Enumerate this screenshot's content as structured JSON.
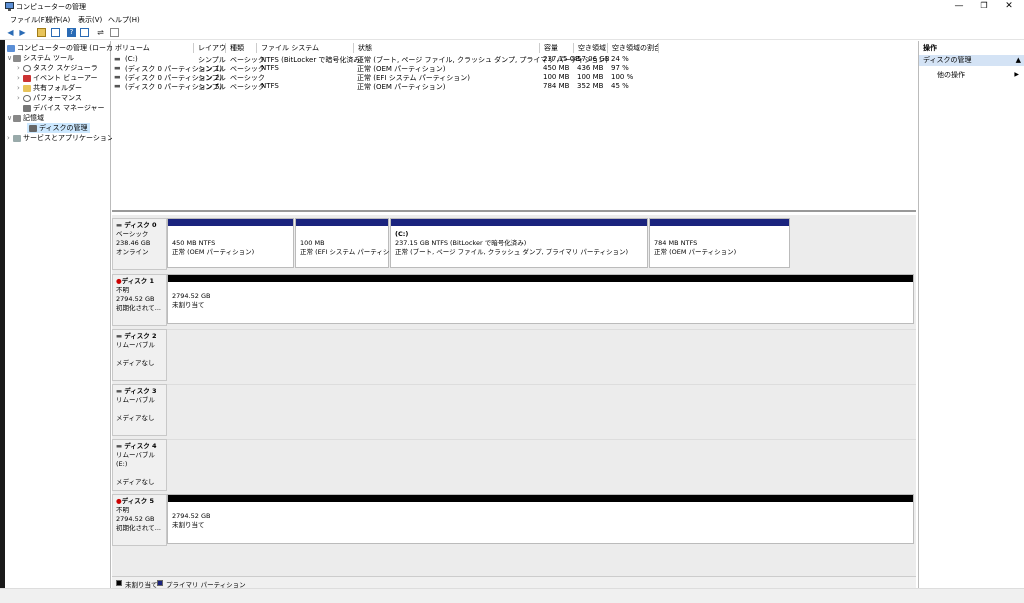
{
  "window": {
    "title": "コンピューターの管理",
    "minimize": "—",
    "restore": "❐",
    "close": "✕"
  },
  "menu": [
    "ファイル(F)",
    "操作(A)",
    "表示(V)",
    "ヘルプ(H)"
  ],
  "tree": {
    "root": "コンピューターの管理 (ローカル)",
    "system_tools": "システム ツール",
    "task_scheduler": "タスク スケジューラ",
    "event_viewer": "イベント ビューアー",
    "shared_folders": "共有フォルダー",
    "performance": "パフォーマンス",
    "device_manager": "デバイス マネージャー",
    "storage": "記憶域",
    "disk_management": "ディスクの管理",
    "services_apps": "サービスとアプリケーション"
  },
  "volume_columns": [
    "ボリューム",
    "レイアウト",
    "種類",
    "ファイル システム",
    "状態",
    "容量",
    "空き領域",
    "空き領域の割合"
  ],
  "volumes": [
    {
      "name": "(C:)",
      "layout": "シンプル",
      "type": "ベーシック",
      "fs": "NTFS (BitLocker で暗号化済み)",
      "status": "正常 (ブート, ページ ファイル, クラッシュ ダンプ, プライマリ パーティション)",
      "capacity": "237.15 GB",
      "free": "57.06 GB",
      "pct": "24 %"
    },
    {
      "name": "(ディスク 0 パーティション 1)",
      "layout": "シンプル",
      "type": "ベーシック",
      "fs": "NTFS",
      "status": "正常 (OEM パーティション)",
      "capacity": "450 MB",
      "free": "436 MB",
      "pct": "97 %"
    },
    {
      "name": "(ディスク 0 パーティション 2)",
      "layout": "シンプル",
      "type": "ベーシック",
      "fs": "",
      "status": "正常 (EFI システム パーティション)",
      "capacity": "100 MB",
      "free": "100 MB",
      "pct": "100 %"
    },
    {
      "name": "(ディスク 0 パーティション 5)",
      "layout": "シンプル",
      "type": "ベーシック",
      "fs": "NTFS",
      "status": "正常 (OEM パーティション)",
      "capacity": "784 MB",
      "free": "352 MB",
      "pct": "45 %"
    }
  ],
  "disks": {
    "d0": {
      "name": "ディスク 0",
      "type": "ベーシック",
      "size": "238.46 GB",
      "status": "オンライン",
      "parts": [
        {
          "title": "",
          "line1": "450 MB NTFS",
          "line2": "正常 (OEM パーティション)"
        },
        {
          "title": "",
          "line1": "100 MB",
          "line2": "正常 (EFI システム パーティション)"
        },
        {
          "title": "(C:)",
          "line1": "237.15 GB NTFS (BitLocker で暗号化済み)",
          "line2": "正常 (ブート, ページ ファイル, クラッシュ ダンプ, プライマリ パーティション)"
        },
        {
          "title": "",
          "line1": "784 MB NTFS",
          "line2": "正常 (OEM パーティション)"
        }
      ]
    },
    "d1": {
      "name": "ディスク 1",
      "type": "不明",
      "size": "2794.52 GB",
      "status": "初期化されて...",
      "part_size": "2794.52 GB",
      "part_status": "未割り当て"
    },
    "d2": {
      "name": "ディスク 2",
      "type": "リムーバブル",
      "status": "メディアなし"
    },
    "d3": {
      "name": "ディスク 3",
      "type": "リムーバブル",
      "status": "メディアなし"
    },
    "d4": {
      "name": "ディスク 4",
      "type": "リムーバブル (E:)",
      "status": "メディアなし"
    },
    "d5": {
      "name": "ディスク 5",
      "type": "不明",
      "size": "2794.52 GB",
      "status": "初期化されて...",
      "part_size": "2794.52 GB",
      "part_status": "未割り当て"
    }
  },
  "legend": {
    "unallocated": "未割り当て",
    "primary": "プライマリ パーティション"
  },
  "actions": {
    "header": "操作",
    "section": "ディスクの管理",
    "more": "他の操作"
  },
  "colors": {
    "primary_partition": "#1a237e",
    "unallocated": "#000000",
    "selection": "#cce8ff",
    "action_section": "#d4e3f5"
  }
}
